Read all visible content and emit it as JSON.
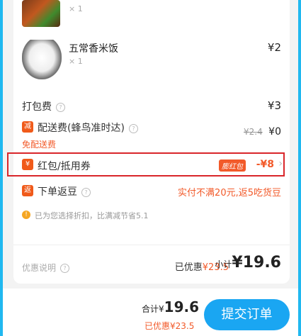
{
  "items": [
    {
      "name": "",
      "qty": "× 1",
      "price": ""
    },
    {
      "name": "五常香米饭",
      "qty": "× 1",
      "price": "¥2"
    }
  ],
  "fees": {
    "packing_label": "打包费",
    "packing_price": "¥3",
    "delivery_tag": "减",
    "delivery_label": "配送费(蜂鸟准时达)",
    "delivery_old": "¥2.4",
    "delivery_new": "¥0",
    "delivery_note": "免配送费"
  },
  "coupon": {
    "tag": "¥",
    "label": "红包/抵用券",
    "badge": "膨红包",
    "value": "-¥8"
  },
  "rebate": {
    "tag": "返",
    "label": "下单返豆",
    "text": "实付不满20元,返5吃货豆"
  },
  "discount_note": "已为您选择折扣，比满减节省5.1",
  "summary": {
    "help_label": "优惠说明",
    "saved_label": "已优惠",
    "saved_value": "¥23.5",
    "subtotal_label": "小计",
    "subtotal_value": "¥19.6"
  },
  "bottom": {
    "total_label": "合计",
    "total_currency": "¥",
    "total_value": "19.6",
    "saved_text": "已优惠¥23.5",
    "submit_label": "提交订单"
  }
}
